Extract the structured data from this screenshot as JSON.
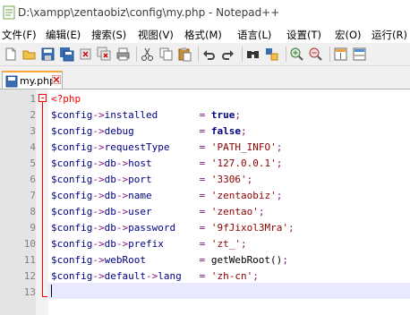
{
  "window": {
    "title": "D:\\xampp\\zentaobiz\\config\\my.php - Notepad++"
  },
  "menu": [
    "文件(F)",
    "编辑(E)",
    "搜索(S)",
    "视图(V)",
    "格式(M)",
    "语言(L)",
    "设置(T)",
    "宏(O)",
    "运行(R)"
  ],
  "toolbar": {
    "icons": [
      "new-file-icon",
      "open-file-icon",
      "save-icon",
      "save-all-icon",
      "close-icon",
      "close-all-icon",
      "print-icon",
      "cut-icon",
      "copy-icon",
      "paste-icon",
      "undo-icon",
      "redo-icon",
      "find-icon",
      "replace-icon",
      "zoom-in-icon",
      "zoom-out-icon",
      "sync-vertical-icon",
      "sync-horizontal-icon"
    ]
  },
  "tab": {
    "label": "my.php"
  },
  "editor": {
    "line_numbers": [
      "1",
      "2",
      "3",
      "4",
      "5",
      "6",
      "7",
      "8",
      "9",
      "10",
      "11",
      "12",
      "13"
    ],
    "lines": [
      {
        "open": "<?php"
      },
      {
        "var": "$config->",
        "prop": "installed",
        "pad": "       ",
        "op": "= ",
        "val": "true",
        "vtype": "kw",
        "end": ";"
      },
      {
        "var": "$config->",
        "prop": "debug",
        "pad": "           ",
        "op": "= ",
        "val": "false",
        "vtype": "kw",
        "end": ";"
      },
      {
        "var": "$config->",
        "prop": "requestType",
        "pad": "     ",
        "op": "= ",
        "val": "'PATH_INFO'",
        "vtype": "str",
        "end": ";"
      },
      {
        "var": "$config->db->",
        "prop": "host",
        "pad": "        ",
        "op": "= ",
        "val": "'127.0.0.1'",
        "vtype": "str",
        "end": ";"
      },
      {
        "var": "$config->db->",
        "prop": "port",
        "pad": "        ",
        "op": "= ",
        "val": "'3306'",
        "vtype": "str",
        "end": ";"
      },
      {
        "var": "$config->db->",
        "prop": "name",
        "pad": "        ",
        "op": "= ",
        "val": "'zentaobiz'",
        "vtype": "str",
        "end": ";"
      },
      {
        "var": "$config->db->",
        "prop": "user",
        "pad": "        ",
        "op": "= ",
        "val": "'zentao'",
        "vtype": "str",
        "end": ";"
      },
      {
        "var": "$config->db->",
        "prop": "password",
        "pad": "    ",
        "op": "= ",
        "val": "'9fJixol3Mra'",
        "vtype": "str",
        "end": ";"
      },
      {
        "var": "$config->db->",
        "prop": "prefix",
        "pad": "      ",
        "op": "= ",
        "val": "'zt_'",
        "vtype": "str",
        "end": ";"
      },
      {
        "var": "$config->",
        "prop": "webRoot",
        "pad": "         ",
        "op": "= ",
        "val": "getWebRoot()",
        "vtype": "func",
        "end": ";"
      },
      {
        "var": "$config->default->",
        "prop": "lang",
        "pad": "   ",
        "op": "= ",
        "val": "'zh-cn'",
        "vtype": "str",
        "end": ";"
      },
      {
        "empty": ""
      }
    ]
  }
}
